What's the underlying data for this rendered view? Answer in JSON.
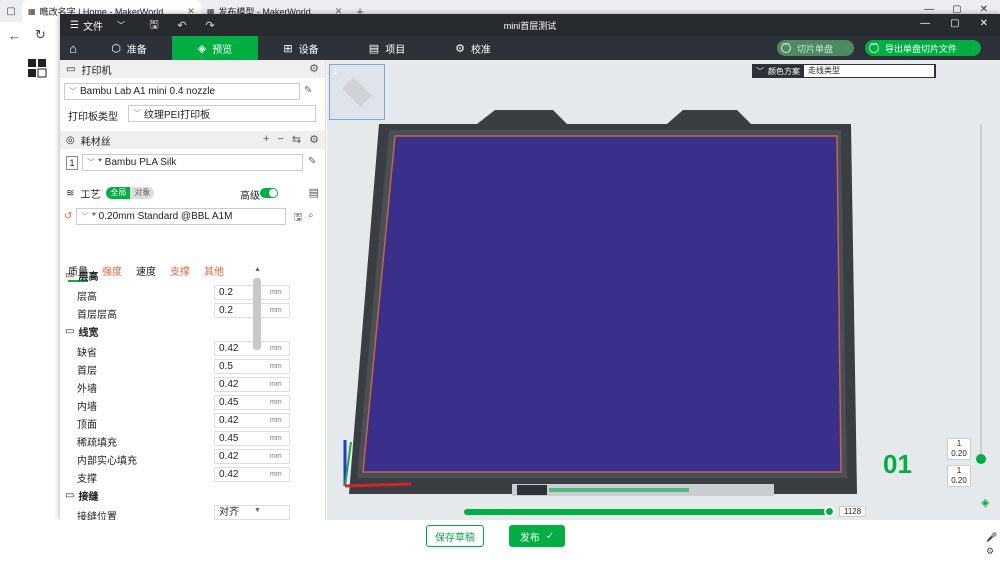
{
  "browser": {
    "tabs": [
      {
        "label": "瞧改名字 | Home - MakerWorld",
        "active": true
      },
      {
        "label": "发布模型 - MakerWorld",
        "active": false
      }
    ]
  },
  "app": {
    "window_title": "mini首层测试",
    "file_menu": "文件",
    "nav": {
      "tabs": [
        {
          "label": "准备",
          "icon": "cube-icon"
        },
        {
          "label": "预览",
          "icon": "layers-icon",
          "active": true
        },
        {
          "label": "设备",
          "icon": "device-icon"
        },
        {
          "label": "项目",
          "icon": "project-icon"
        },
        {
          "label": "校准",
          "icon": "calibrate-icon"
        }
      ],
      "slice_label": "切片单盘",
      "export_label": "导出单盘切片文件"
    },
    "printer": {
      "section_title": "打印机",
      "printer_name": "Bambu Lab A1 mini 0.4 nozzle",
      "plate_type_label": "打印板类型",
      "plate_type_value": "纹理PEI打印板"
    },
    "filament": {
      "section_title": "耗材丝",
      "slot_number": "1",
      "name": "* Bambu PLA Silk"
    },
    "process": {
      "section_title": "工艺",
      "toggle_global": "全局",
      "toggle_object": "对象",
      "advanced_label": "高级",
      "profile": "* 0.20mm Standard @BBL A1M",
      "tabs": [
        "质量",
        "强度",
        "速度",
        "支撑",
        "其他"
      ],
      "groups": [
        {
          "title": "层高",
          "params": [
            {
              "label": "层高",
              "value": "0.2",
              "unit": "mm"
            },
            {
              "label": "首层层高",
              "value": "0.2",
              "unit": "mm"
            }
          ]
        },
        {
          "title": "线宽",
          "params": [
            {
              "label": "缺省",
              "value": "0.42",
              "unit": "mm"
            },
            {
              "label": "首层",
              "value": "0.5",
              "unit": "mm"
            },
            {
              "label": "外墙",
              "value": "0.42",
              "unit": "mm"
            },
            {
              "label": "内墙",
              "value": "0.45",
              "unit": "mm"
            },
            {
              "label": "顶面",
              "value": "0.42",
              "unit": "mm"
            },
            {
              "label": "稀疏填充",
              "value": "0.45",
              "unit": "mm"
            },
            {
              "label": "内部实心填充",
              "value": "0.42",
              "unit": "mm"
            },
            {
              "label": "支撑",
              "value": "0.42",
              "unit": "mm"
            }
          ]
        },
        {
          "title": "接缝",
          "params": [
            {
              "label": "接缝位置",
              "value": "对齐",
              "unit": ""
            }
          ]
        }
      ]
    },
    "viewport": {
      "thumb_number": "1",
      "color_scheme_label": "颜色方案",
      "color_scheme_value": "走线类型",
      "plate_number": "01",
      "layer_top_num": "1",
      "layer_top_h": "0.20",
      "layer_bot_num": "1",
      "layer_bot_h": "0.20",
      "slider_value": "1128",
      "colors": {
        "accent": "#00ae42",
        "print_fill": "#3b2f8c",
        "bed": "#3a3d42"
      }
    }
  },
  "page": {
    "save_draft_label": "保存草稿",
    "publish_label": "发布"
  }
}
